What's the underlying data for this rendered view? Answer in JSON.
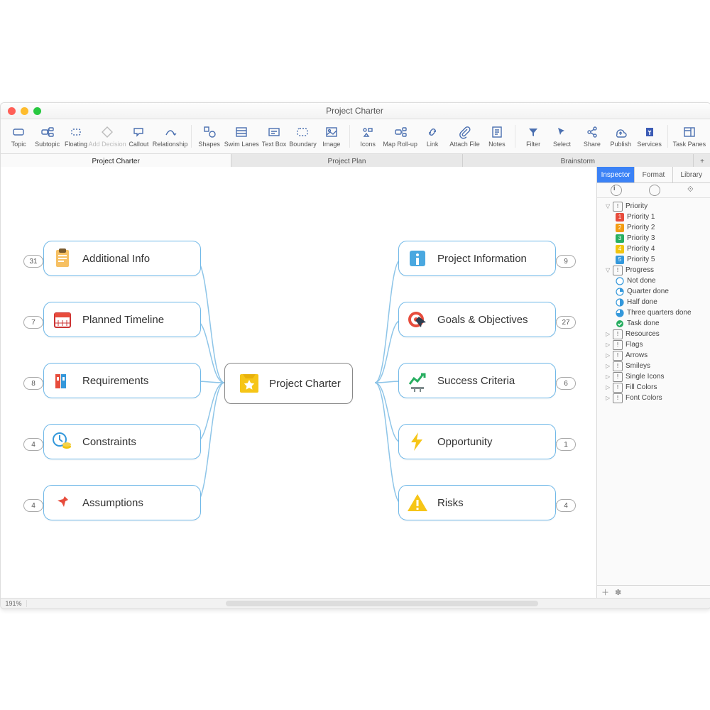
{
  "window": {
    "title": "Project Charter"
  },
  "toolbar": [
    {
      "id": "topic",
      "label": "Topic"
    },
    {
      "id": "subtopic",
      "label": "Subtopic"
    },
    {
      "id": "floating",
      "label": "Floating"
    },
    {
      "id": "add-decision",
      "label": "Add Decision",
      "dis": true
    },
    {
      "id": "callout",
      "label": "Callout"
    },
    {
      "id": "relationship",
      "label": "Relationship"
    },
    {
      "sep": true
    },
    {
      "id": "shapes",
      "label": "Shapes"
    },
    {
      "id": "swim-lanes",
      "label": "Swim Lanes",
      "wide": true
    },
    {
      "id": "text-box",
      "label": "Text Box"
    },
    {
      "id": "boundary",
      "label": "Boundary"
    },
    {
      "id": "image",
      "label": "Image"
    },
    {
      "sep": true
    },
    {
      "id": "icons",
      "label": "Icons"
    },
    {
      "id": "map-rollup",
      "label": "Map Roll-up",
      "wide": true
    },
    {
      "id": "link",
      "label": "Link"
    },
    {
      "id": "attach-file",
      "label": "Attach File",
      "wide": true
    },
    {
      "id": "notes",
      "label": "Notes"
    },
    {
      "sep": true
    },
    {
      "id": "filter",
      "label": "Filter"
    },
    {
      "id": "select",
      "label": "Select"
    },
    {
      "flex": true
    },
    {
      "id": "share",
      "label": "Share"
    },
    {
      "id": "publish",
      "label": "Publish"
    },
    {
      "id": "services",
      "label": "Services"
    },
    {
      "sep": true
    },
    {
      "id": "task-panes",
      "label": "Task Panes",
      "wide": true
    }
  ],
  "docTabs": [
    "Project Charter",
    "Project Plan",
    "Brainstorm"
  ],
  "activeDocTab": 0,
  "center": {
    "label": "Project Charter"
  },
  "leftNodes": [
    {
      "label": "Additional Info",
      "badge": "31",
      "icon": "clipboard"
    },
    {
      "label": "Planned Timeline",
      "badge": "7",
      "icon": "calendar"
    },
    {
      "label": "Requirements",
      "badge": "8",
      "icon": "books"
    },
    {
      "label": "Constraints",
      "badge": "4",
      "icon": "clock-coins"
    },
    {
      "label": "Assumptions",
      "badge": "4",
      "icon": "pin"
    }
  ],
  "rightNodes": [
    {
      "label": "Project Information",
      "badge": "9",
      "icon": "info"
    },
    {
      "label": "Goals & Objectives",
      "badge": "27",
      "icon": "target"
    },
    {
      "label": "Success Criteria",
      "badge": "6",
      "icon": "chart"
    },
    {
      "label": "Opportunity",
      "badge": "1",
      "icon": "bolt"
    },
    {
      "label": "Risks",
      "badge": "4",
      "icon": "warning"
    }
  ],
  "inspector": {
    "tabs": [
      "Inspector",
      "Format",
      "Library"
    ],
    "activeTab": 0,
    "tree": [
      {
        "label": "Priority",
        "open": true,
        "icon": "excl",
        "children": [
          {
            "label": "Priority 1",
            "color": "#e74c3c"
          },
          {
            "label": "Priority 2",
            "color": "#f39c12"
          },
          {
            "label": "Priority 3",
            "color": "#27ae60"
          },
          {
            "label": "Priority 4",
            "color": "#f1c40f"
          },
          {
            "label": "Priority 5",
            "color": "#3498db"
          }
        ]
      },
      {
        "label": "Progress",
        "open": true,
        "icon": "circle",
        "children": [
          {
            "label": "Not done",
            "prog": 0
          },
          {
            "label": "Quarter done",
            "prog": 25
          },
          {
            "label": "Half done",
            "prog": 50
          },
          {
            "label": "Three quarters done",
            "prog": 75
          },
          {
            "label": "Task done",
            "prog": 100
          }
        ]
      },
      {
        "label": "Resources",
        "icon": "person"
      },
      {
        "label": "Flags",
        "icon": "flag"
      },
      {
        "label": "Arrows",
        "icon": "arrow"
      },
      {
        "label": "Smileys",
        "icon": "smiley"
      },
      {
        "label": "Single Icons",
        "icon": "single"
      },
      {
        "label": "Fill Colors",
        "icon": "fill"
      },
      {
        "label": "Font Colors",
        "icon": "font"
      }
    ]
  },
  "status": {
    "zoom": "191%"
  }
}
